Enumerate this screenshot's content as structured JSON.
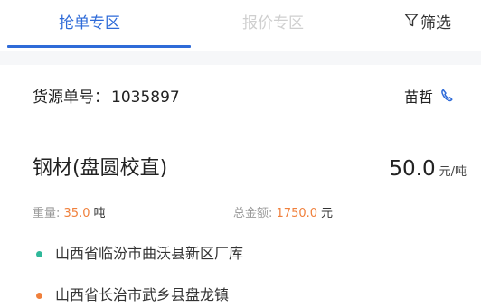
{
  "tabs": {
    "grab": "抢单专区",
    "quote": "报价专区",
    "filter": "筛选"
  },
  "order": {
    "waybill_label": "货源单号：",
    "waybill_no": "1035897",
    "contact_name": "苗哲",
    "goods": "钢材(盘圆校直)",
    "price_value": "50.0",
    "price_unit": "元/吨",
    "weight_label": "重量:",
    "weight_value": "35.0",
    "weight_unit": "吨",
    "amount_label": "总金额:",
    "amount_value": "1750.0",
    "amount_unit": "元",
    "origin": "山西省临汾市曲沃县新区厂库",
    "destination": "山西省长治市武乡县盘龙镇"
  },
  "colors": {
    "accent": "#2f6bd8",
    "origin_dot": "#2fb89a",
    "destination_dot": "#f0803c",
    "highlight": "#f0803c"
  },
  "icons": {
    "filter": "filter-icon",
    "phone": "phone-icon"
  }
}
